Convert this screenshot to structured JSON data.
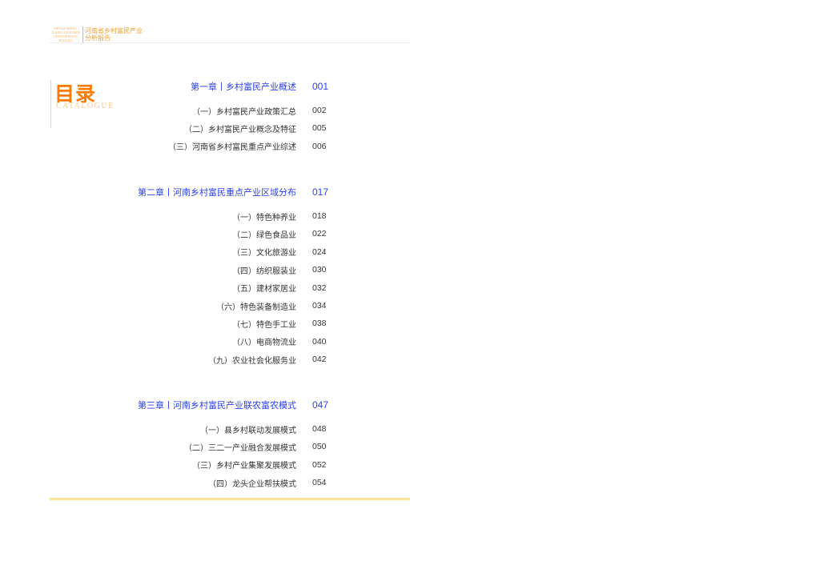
{
  "header": {
    "logo_en": "HENAN SHENG XIANGCUN FUMIN CHANYE FENXI BAOGAO",
    "logo_cn_line1": "河南省乡村富民产业",
    "logo_cn_line2": "分析报告"
  },
  "toc": {
    "title": "目录",
    "subtitle": "CATALOGUE",
    "chapters": [
      {
        "title": "第一章丨乡村富民产业概述",
        "page": "001",
        "items": [
          {
            "title": "（一）乡村富民产业政策汇总",
            "page": "002"
          },
          {
            "title": "（二）乡村富民产业概念及特征",
            "page": "005"
          },
          {
            "title": "（三）河南省乡村富民重点产业综述",
            "page": "006"
          }
        ]
      },
      {
        "title": "第二章丨河南乡村富民重点产业区域分布",
        "page": "017",
        "items": [
          {
            "title": "（一）特色种养业",
            "page": "018"
          },
          {
            "title": "（二）绿色食品业",
            "page": "022"
          },
          {
            "title": "（三）文化旅游业",
            "page": "024"
          },
          {
            "title": "（四）纺织服装业",
            "page": "030"
          },
          {
            "title": "（五）建材家居业",
            "page": "032"
          },
          {
            "title": "（六）特色装备制造业",
            "page": "034"
          },
          {
            "title": "（七）特色手工业",
            "page": "038"
          },
          {
            "title": "（八）电商物流业",
            "page": "040"
          },
          {
            "title": "（九）农业社会化服务业",
            "page": "042"
          }
        ]
      },
      {
        "title": "第三章丨河南乡村富民产业联农富农模式",
        "page": "047",
        "items": [
          {
            "title": "（一）县乡村联动发展模式",
            "page": "048"
          },
          {
            "title": "（二）三二一产业融合发展模式",
            "page": "050"
          },
          {
            "title": "（三）乡村产业集聚发展模式",
            "page": "052"
          },
          {
            "title": "（四）龙头企业帮扶模式",
            "page": "054"
          }
        ]
      }
    ]
  }
}
